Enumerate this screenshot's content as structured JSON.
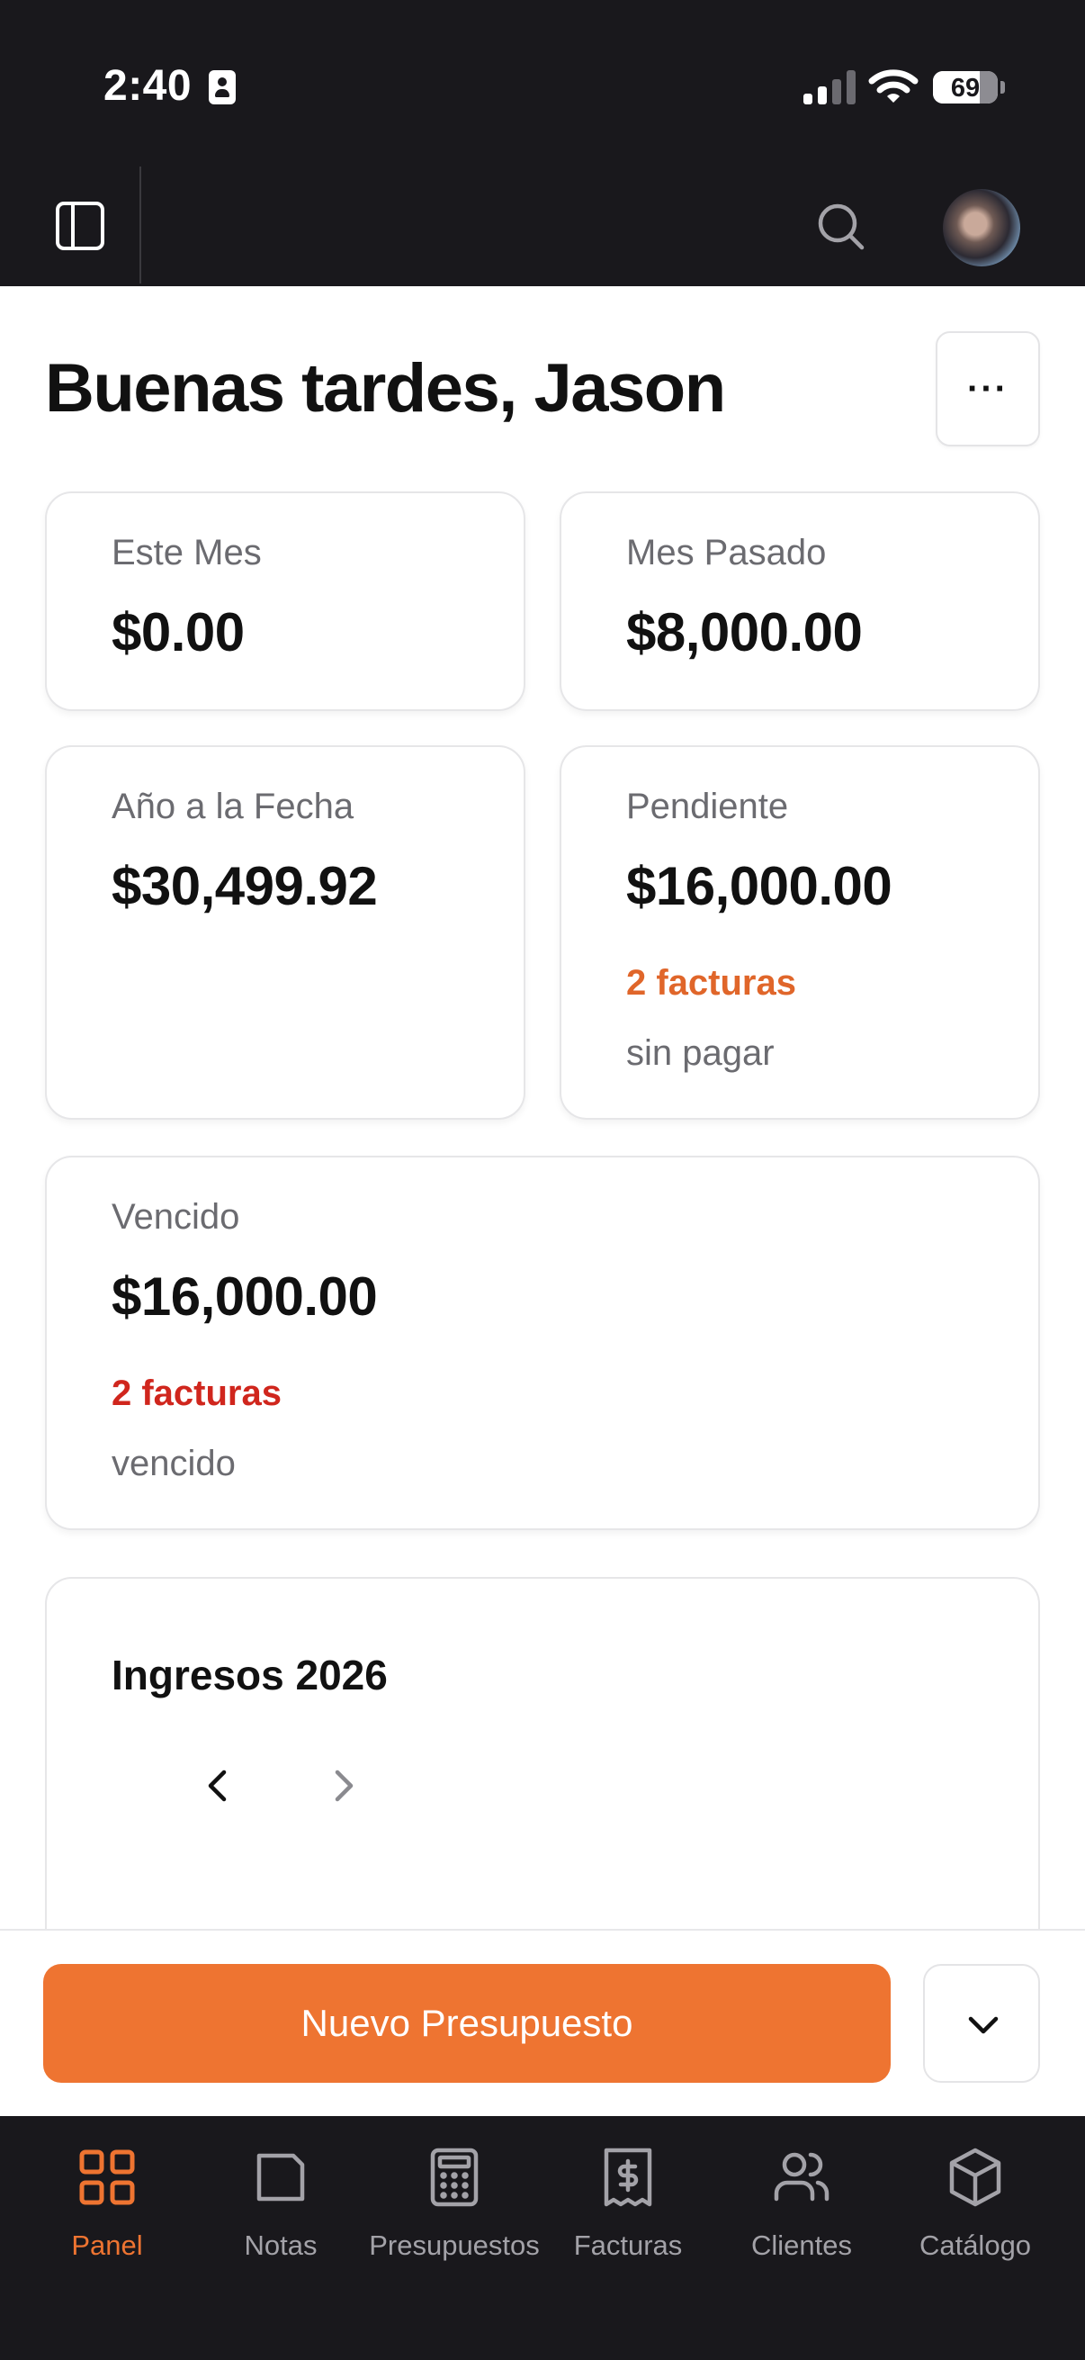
{
  "status_bar": {
    "time": "2:40",
    "battery": "69"
  },
  "header": {
    "avatar_alt": ""
  },
  "greeting": "Buenas tardes, Jason",
  "more_button_label": "···",
  "cards": {
    "this_month": {
      "label": "Este Mes",
      "amount": "$0.00"
    },
    "last_month": {
      "label": "Mes Pasado",
      "amount": "$8,000.00"
    },
    "ytd": {
      "label": "Año a la Fecha",
      "amount": "$30,499.92"
    },
    "pending": {
      "label": "Pendiente",
      "amount": "$16,000.00",
      "count": "2 facturas",
      "note": "sin pagar",
      "accent": "#e0662a"
    },
    "overdue": {
      "label": "Vencido",
      "amount": "$16,000.00",
      "count": "2 facturas",
      "note": "vencido",
      "accent": "#d0261d"
    }
  },
  "chart": {
    "title": "Ingresos 2026"
  },
  "actions": {
    "primary_label": "Nuevo Presupuesto",
    "accent": "#ee7431"
  },
  "tabs": [
    {
      "label": "Panel",
      "icon": "grid-icon",
      "active": true
    },
    {
      "label": "Notas",
      "icon": "note-icon",
      "active": false
    },
    {
      "label": "Presupuestos",
      "icon": "calculator-icon",
      "active": false
    },
    {
      "label": "Facturas",
      "icon": "receipt-icon",
      "active": false
    },
    {
      "label": "Clientes",
      "icon": "users-icon",
      "active": false
    },
    {
      "label": "Catálogo",
      "icon": "box-icon",
      "active": false
    }
  ]
}
